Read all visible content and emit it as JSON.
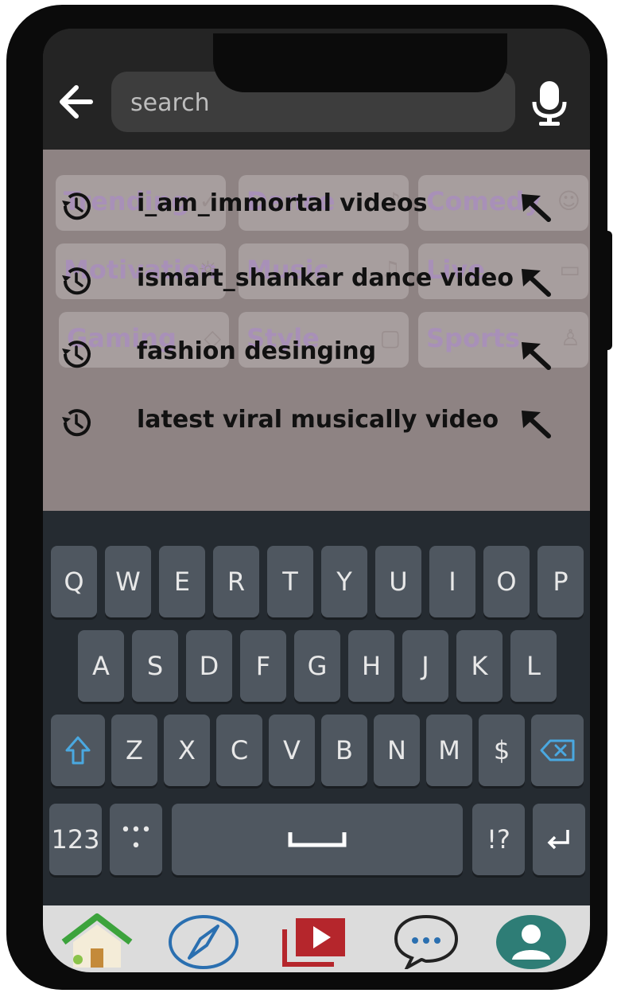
{
  "search": {
    "placeholder": "search"
  },
  "categories": [
    {
      "label": "Trending",
      "icon": "trending-icon"
    },
    {
      "label": "Dance",
      "icon": "dance-icon"
    },
    {
      "label": "Comedy",
      "icon": "smile-icon"
    },
    {
      "label": "Motivation",
      "icon": "bulb-icon"
    },
    {
      "label": "Music",
      "icon": "music-note-icon"
    },
    {
      "label": "Live",
      "icon": "tv-icon"
    },
    {
      "label": "Gaming",
      "icon": "gamepad-icon"
    },
    {
      "label": "Style",
      "icon": "shopping-bag-icon"
    },
    {
      "label": "Sports",
      "icon": "athlete-icon"
    }
  ],
  "history": [
    {
      "text": "i_am_immortal videos"
    },
    {
      "text": "ismart_shankar dance video"
    },
    {
      "text": "fashion desinging"
    },
    {
      "text": "latest viral musically video"
    }
  ],
  "keyboard": {
    "row1": [
      "Q",
      "W",
      "E",
      "R",
      "T",
      "Y",
      "U",
      "I",
      "O",
      "P"
    ],
    "row2": [
      "A",
      "S",
      "D",
      "F",
      "G",
      "H",
      "J",
      "K",
      "L"
    ],
    "row3": [
      "Z",
      "X",
      "C",
      "V",
      "B",
      "N",
      "M",
      "$"
    ],
    "numbers_key": "123",
    "punct_key": "!?"
  },
  "nav": [
    "home-icon",
    "explore-compass-icon",
    "video-library-icon",
    "messages-icon",
    "profile-icon"
  ],
  "colors": {
    "suggest_bg": "#8e8383",
    "keyboard_bg": "#252b31",
    "key_bg": "#4f5760",
    "accent_blue": "#2a6fb0",
    "profile_teal": "#2e7d76",
    "library_red": "#b5262c"
  }
}
